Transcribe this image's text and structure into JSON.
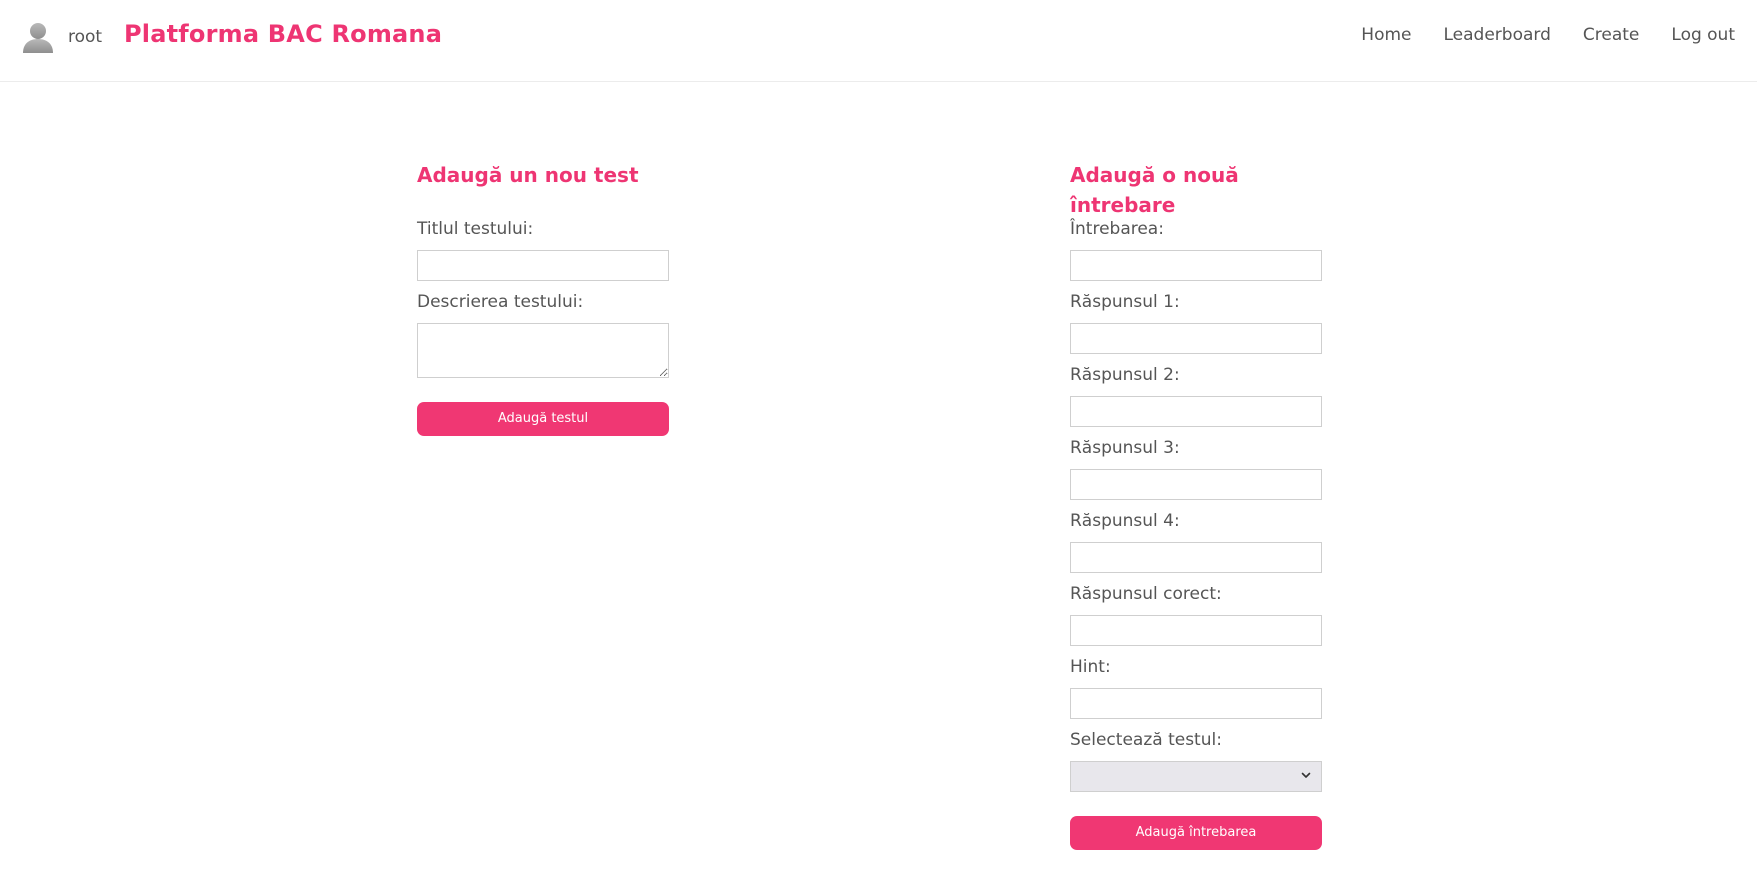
{
  "header": {
    "username": "root",
    "brand": "Platforma BAC Romana",
    "nav": [
      "Home",
      "Leaderboard",
      "Create",
      "Log out"
    ]
  },
  "test_form": {
    "title": "Adaugă un nou test",
    "title_label": "Titlul testului:",
    "title_value": "",
    "description_label": "Descrierea testului:",
    "description_value": "",
    "submit_label": "Adaugă testul"
  },
  "question_form": {
    "title": "Adaugă o nouă întrebare",
    "question_label": "Întrebarea:",
    "answer1_label": "Răspunsul 1:",
    "answer2_label": "Răspunsul 2:",
    "answer3_label": "Răspunsul 3:",
    "answer4_label": "Răspunsul 4:",
    "correct_label": "Răspunsul corect:",
    "hint_label": "Hint:",
    "select_label": "Selectează testul:",
    "select_value": "",
    "submit_label": "Adaugă întrebarea"
  },
  "colors": {
    "accent": "#ee3573",
    "button": "#f03773",
    "text": "#555555",
    "select_bg": "#e8e7ec"
  },
  "icons": {
    "avatar": "user-avatar-icon",
    "dropdown": "chevron-down-icon"
  }
}
